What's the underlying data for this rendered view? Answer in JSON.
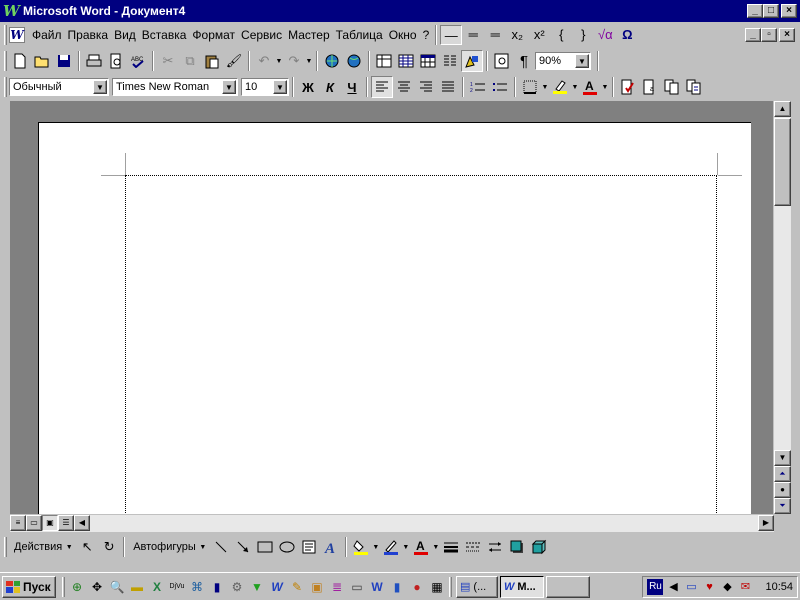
{
  "window": {
    "app_icon": "word-w-icon",
    "title": "Microsoft Word - Документ4",
    "minimize": "_",
    "maximize": "□",
    "close": "×"
  },
  "menubar": {
    "items": [
      {
        "label": "Файл",
        "name": "menu-file"
      },
      {
        "label": "Правка",
        "name": "menu-edit"
      },
      {
        "label": "Вид",
        "name": "menu-view"
      },
      {
        "label": "Вставка",
        "name": "menu-insert"
      },
      {
        "label": "Формат",
        "name": "menu-format"
      },
      {
        "label": "Сервис",
        "name": "menu-tools"
      },
      {
        "label": "Мастер",
        "name": "menu-wizard"
      },
      {
        "label": "Таблица",
        "name": "menu-table"
      },
      {
        "label": "Окно",
        "name": "menu-window"
      },
      {
        "label": "?",
        "name": "menu-help"
      }
    ],
    "equation_buttons": [
      "—",
      "═",
      "═",
      "x₂",
      "x²",
      "{",
      "}",
      "√α",
      "Ω"
    ],
    "mdi_buttons": [
      "_",
      "▫",
      "×"
    ]
  },
  "standard_toolbar": {
    "zoom": "90%"
  },
  "format_toolbar": {
    "style": "Обычный",
    "font": "Times New Roman",
    "size": "10",
    "bold": "Ж",
    "italic": "К",
    "underline": "Ч"
  },
  "drawing_toolbar": {
    "actions_label": "Действия",
    "autoshapes_label": "Автофигуры"
  },
  "taskbar": {
    "start_label": "Пуск",
    "tasks": [
      {
        "label": "(...",
        "name": "task-explorer"
      },
      {
        "label": "М...",
        "name": "task-word",
        "active": true
      }
    ],
    "tray_lang": "Ru",
    "clock": "10:54"
  },
  "colors": {
    "titlebar": "#000080",
    "face": "#c0c0c0",
    "workspace": "#808080"
  }
}
